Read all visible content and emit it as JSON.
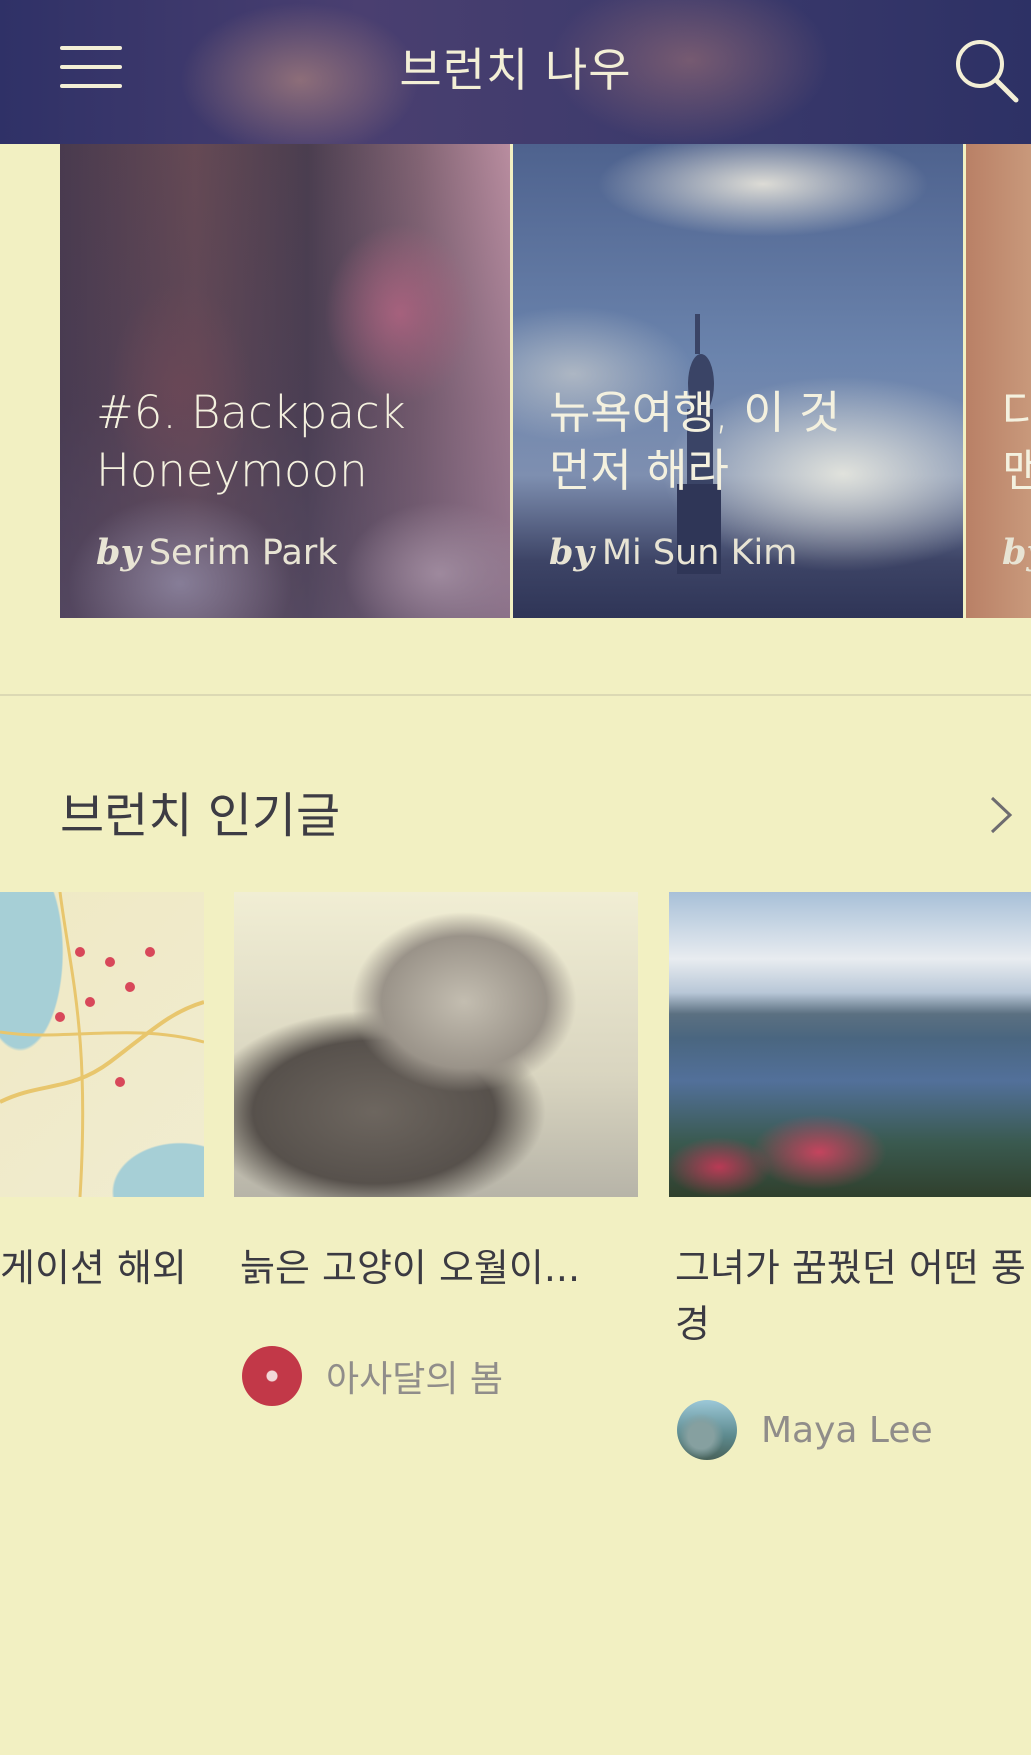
{
  "header": {
    "title": "브런치 나우",
    "menu_icon": "hamburger-menu-icon",
    "search_icon": "search-icon"
  },
  "featured": {
    "cards": [
      {
        "title_line1": "#6. Backpack",
        "title_line2": "Honeymoon",
        "by": "by",
        "author": "Serim Park"
      },
      {
        "title_line1": "뉴욕여행, 이 것",
        "title_line2": "먼저 해라",
        "by": "by",
        "author": "Mi Sun Kim"
      },
      {
        "title_line1": "다",
        "title_line2": "맨",
        "by": "by",
        "author": ""
      }
    ]
  },
  "popular": {
    "title": "브런치 인기글",
    "more_icon": "chevron-right-icon",
    "posts": [
      {
        "title": "게이션 해외",
        "author": ""
      },
      {
        "title": "늙은 고양이 오월이...",
        "author": "아사달의 봄"
      },
      {
        "title": "그녀가 꿈꿨던 어떤 풍경",
        "author": "Maya Lee"
      }
    ]
  },
  "colors": {
    "background": "#f2f0c2",
    "header": "#3c3a6c",
    "text": "#3b3a42",
    "muted": "#908d8a"
  }
}
